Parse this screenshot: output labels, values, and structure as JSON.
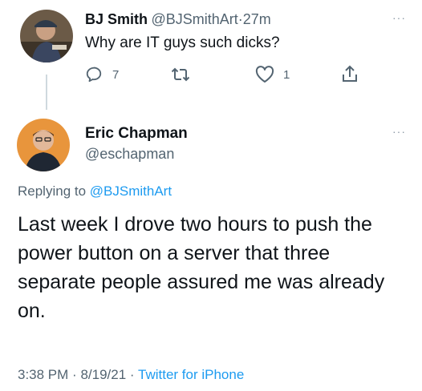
{
  "parent_tweet": {
    "author_name": "BJ Smith",
    "author_handle": "@BJSmithArt",
    "separator": "·",
    "time": "27m",
    "text": "Why are IT guys such dicks?",
    "reply_count": "7",
    "retweet_count": "",
    "like_count": "1",
    "more": "···"
  },
  "main_tweet": {
    "author_name": "Eric Chapman",
    "author_handle": "@eschapman",
    "more": "···",
    "replying_prefix": "Replying to",
    "replying_handle": "@BJSmithArt",
    "text": "Last week I drove two hours to push the power button on a server that three separate people assured me was already on.",
    "time": "3:38 PM",
    "sep1": "·",
    "date": "8/19/21",
    "sep2": "·",
    "source": "Twitter for iPhone"
  },
  "colors": {
    "text": "#0f1419",
    "muted": "#536471",
    "link": "#1d9bf0"
  }
}
